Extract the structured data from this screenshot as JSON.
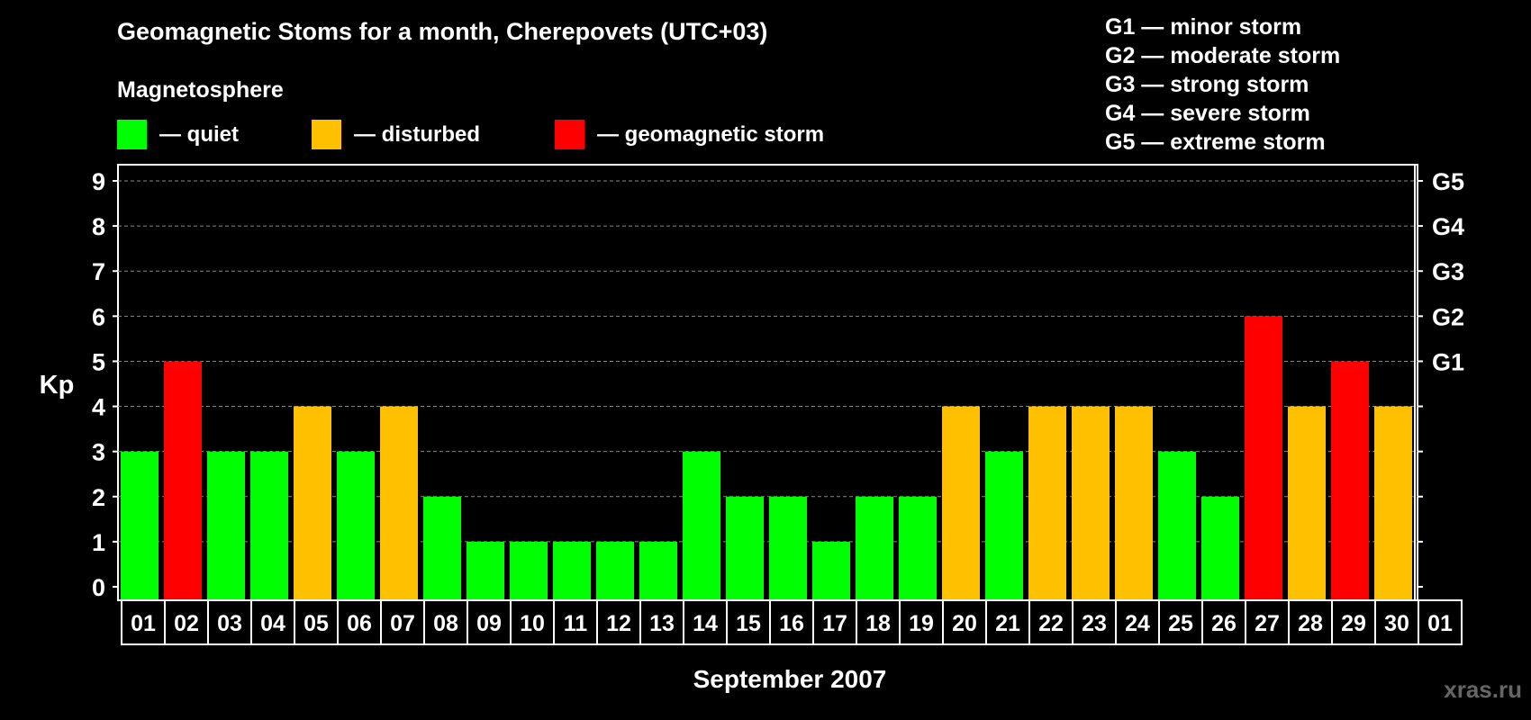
{
  "header": {
    "title": "Geomagnetic Stoms for a month, Cherepovets (UTC+03)",
    "subtitle": "Magnetosphere",
    "legend": [
      {
        "label": "— quiet",
        "color": "#00ff00"
      },
      {
        "label": "— disturbed",
        "color": "#ffc000"
      },
      {
        "label": "— geomagnetic storm",
        "color": "#ff0000"
      }
    ],
    "storm_levels": [
      "G1 — minor storm",
      "G2 — moderate storm",
      "G3 — strong storm",
      "G4 — severe storm",
      "G5 — extreme storm"
    ],
    "watermark": "xras.ru"
  },
  "colors": {
    "quiet": "#00ff00",
    "disturbed": "#ffc000",
    "storm": "#ff0000"
  },
  "chart_data": {
    "type": "bar",
    "title": "Geomagnetic Stoms for a month, Cherepovets (UTC+03)",
    "xlabel": "September 2007",
    "ylabel": "Kp",
    "ylim": [
      0,
      9
    ],
    "y_ticks": [
      "0",
      "1",
      "2",
      "3",
      "4",
      "5",
      "6",
      "7",
      "8",
      "9"
    ],
    "right_ticks": [
      {
        "kp": 5,
        "label": "G1"
      },
      {
        "kp": 6,
        "label": "G2"
      },
      {
        "kp": 7,
        "label": "G3"
      },
      {
        "kp": 8,
        "label": "G4"
      },
      {
        "kp": 9,
        "label": "G5"
      }
    ],
    "grid": true,
    "categories": [
      "01",
      "02",
      "03",
      "04",
      "05",
      "06",
      "07",
      "08",
      "09",
      "10",
      "11",
      "12",
      "13",
      "14",
      "15",
      "16",
      "17",
      "18",
      "19",
      "20",
      "21",
      "22",
      "23",
      "24",
      "25",
      "26",
      "27",
      "28",
      "29",
      "30",
      "01"
    ],
    "values": [
      3,
      5,
      3,
      3,
      4,
      3,
      4,
      2,
      1,
      1,
      1,
      1,
      1,
      3,
      2,
      2,
      1,
      2,
      2,
      4,
      3,
      4,
      4,
      4,
      3,
      2,
      6,
      4,
      5,
      4,
      null
    ],
    "status": [
      "quiet",
      "storm",
      "quiet",
      "quiet",
      "disturbed",
      "quiet",
      "disturbed",
      "quiet",
      "quiet",
      "quiet",
      "quiet",
      "quiet",
      "quiet",
      "quiet",
      "quiet",
      "quiet",
      "quiet",
      "quiet",
      "quiet",
      "disturbed",
      "quiet",
      "disturbed",
      "disturbed",
      "disturbed",
      "quiet",
      "quiet",
      "storm",
      "disturbed",
      "storm",
      "disturbed",
      null
    ]
  }
}
